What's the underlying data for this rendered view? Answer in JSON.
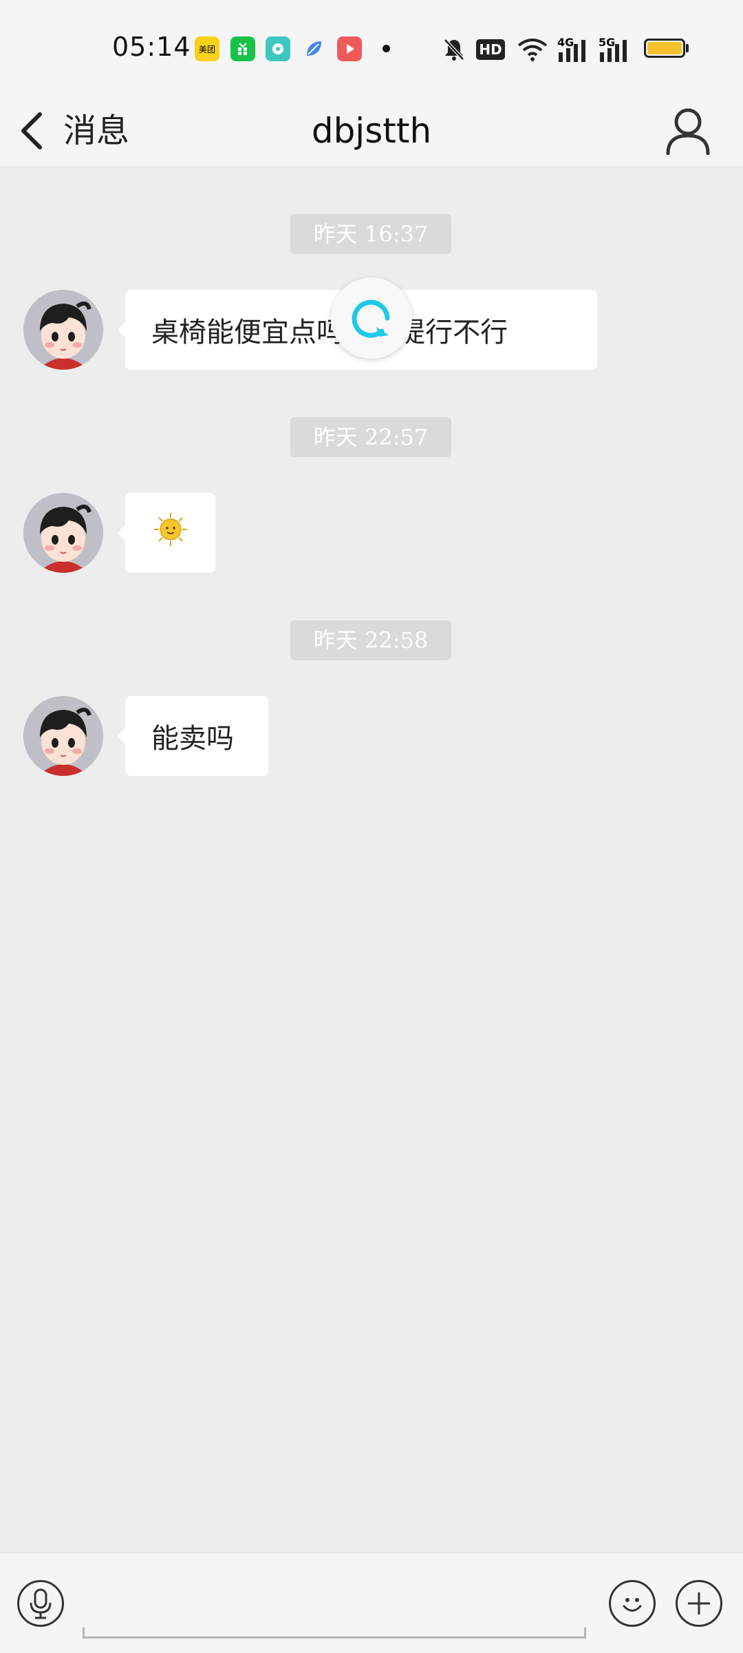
{
  "status_bar": {
    "time": "05:14",
    "app_icons": [
      "meituan-icon",
      "green-app-icon",
      "teal-app-icon",
      "blue-leaf-app-icon",
      "red-video-app-icon"
    ],
    "meituan_text": "美团",
    "network_4g": "4G",
    "network_5g": "5G",
    "hd_text": "HD"
  },
  "header": {
    "back_label": "消息",
    "title": "dbjstth"
  },
  "messages": [
    {
      "timestamp": "昨天 16:37",
      "text": "桌椅能便宜点吗 0自提行不行"
    },
    {
      "timestamp": "昨天 22:57",
      "emoji": "sun-emoji"
    },
    {
      "timestamp": "昨天 22:58",
      "text": "能卖吗"
    }
  ],
  "colors": {
    "accent": "#1ec8e8",
    "battery": "#f6c12c",
    "chat_bg": "#ededed",
    "timestamp_bg": "#dadada"
  }
}
